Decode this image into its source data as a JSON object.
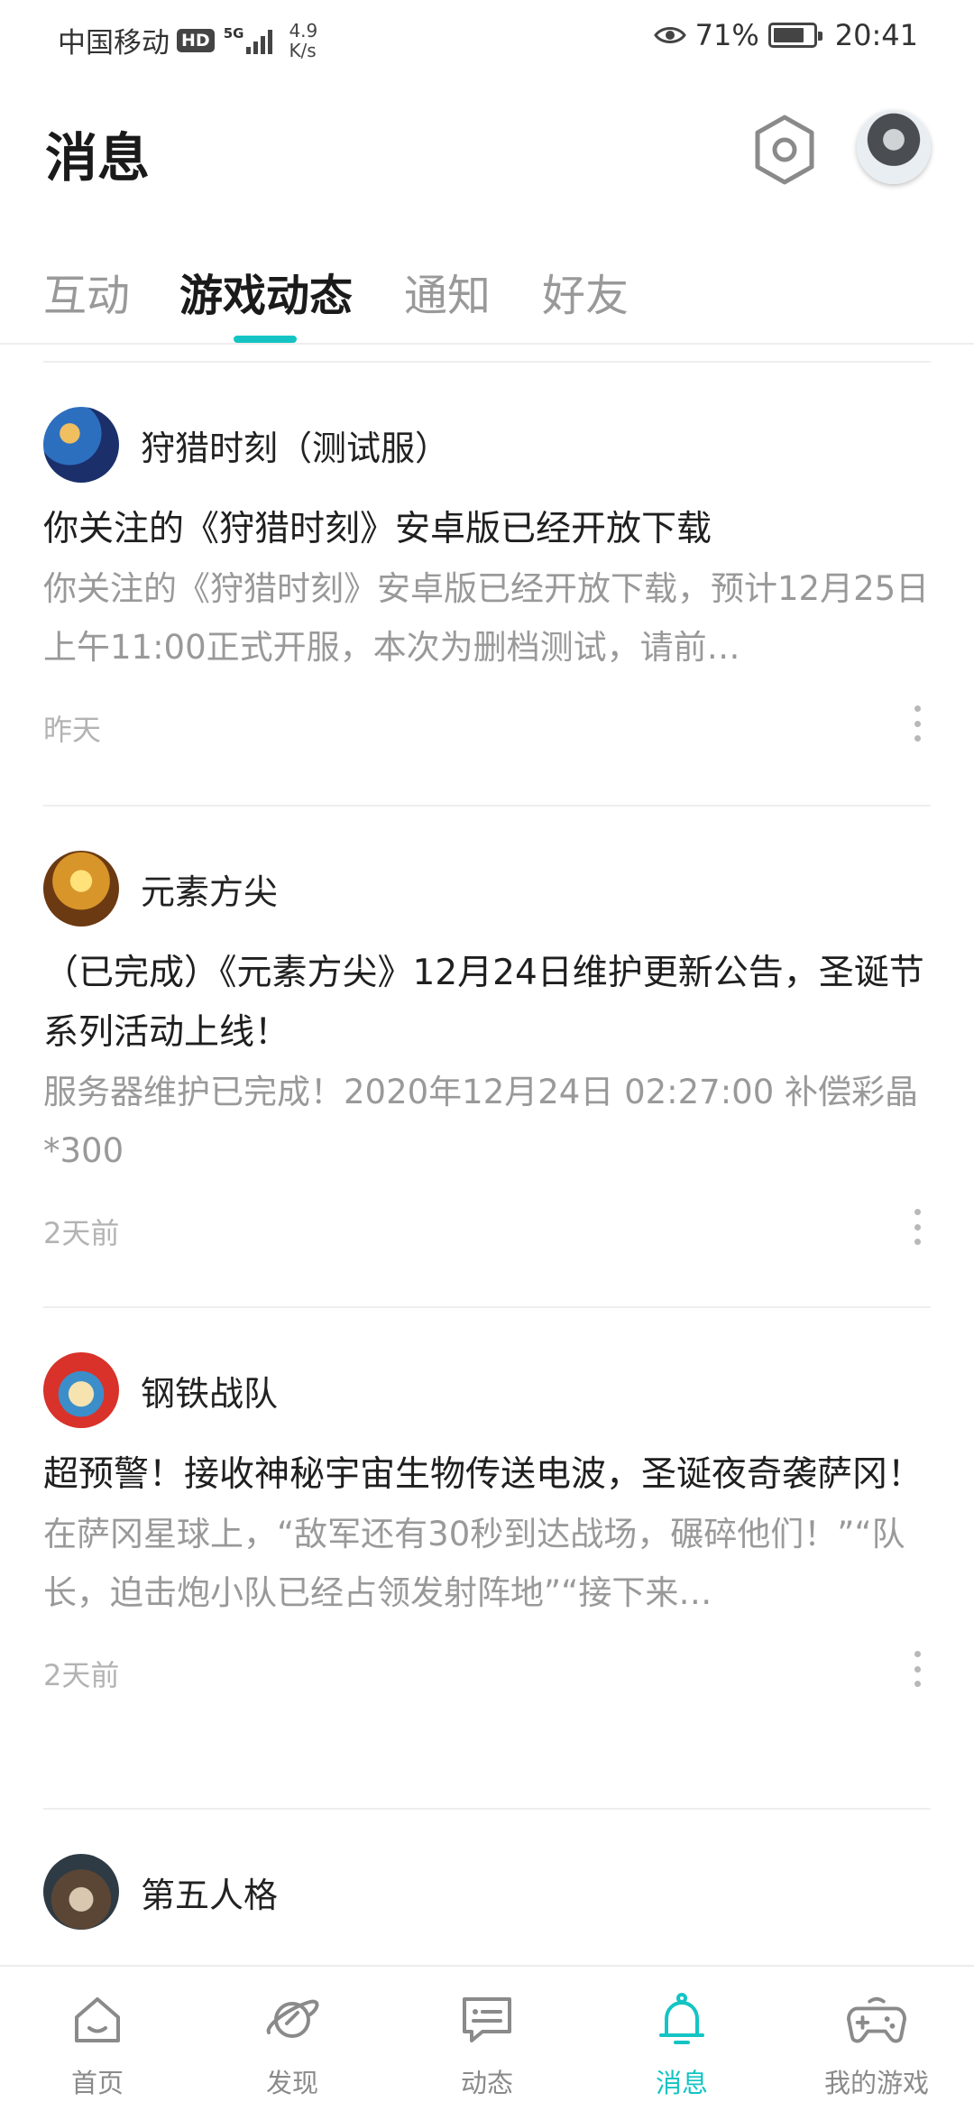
{
  "status_bar": {
    "carrier": "中国移动",
    "hd_badge": "HD",
    "network": "5G",
    "speed_value": "4.9",
    "speed_unit": "K/s",
    "battery_percent": "71%",
    "time": "20:41"
  },
  "header": {
    "title": "消息",
    "settings_icon": "hexagon-settings-icon",
    "avatar_icon": "user-avatar"
  },
  "tabs": [
    {
      "label": "互动",
      "active": false
    },
    {
      "label": "游戏动态",
      "active": true
    },
    {
      "label": "通知",
      "active": false
    },
    {
      "label": "好友",
      "active": false
    }
  ],
  "feed": [
    {
      "game": "狩猎时刻（测试服）",
      "title": "你关注的《狩猎时刻》安卓版已经开放下载",
      "body": "你关注的《狩猎时刻》安卓版已经开放下载，预计12月25日上午11:00正式开服，本次为删档测试，请前…",
      "time": "昨天"
    },
    {
      "game": "元素方尖",
      "title": "（已完成）《元素方尖》12月24日维护更新公告，圣诞节系列活动上线！",
      "body": "服务器维护已完成！2020年12月24日 02:27:00 补偿彩晶*300  =================================…",
      "time": "2天前"
    },
    {
      "game": "钢铁战队",
      "title": "超预警！接收神秘宇宙生物传送电波，圣诞夜奇袭萨冈！",
      "body": "在萨冈星球上，“敌军还有30秒到达战场，碾碎他们！”“队长，迫击炮小队已经占领发射阵地”“接下来…",
      "time": "2天前"
    },
    {
      "game": "第五人格"
    }
  ],
  "bottom_nav": [
    {
      "label": "首页",
      "icon": "home-icon",
      "active": false
    },
    {
      "label": "发现",
      "icon": "planet-icon",
      "active": false
    },
    {
      "label": "动态",
      "icon": "chat-icon",
      "active": false
    },
    {
      "label": "消息",
      "icon": "bell-icon",
      "active": true
    },
    {
      "label": "我的游戏",
      "icon": "gamepad-icon",
      "active": false
    }
  ],
  "colors": {
    "accent": "#14c4c4",
    "text_primary": "#1f1f1f",
    "text_secondary": "#999999"
  }
}
